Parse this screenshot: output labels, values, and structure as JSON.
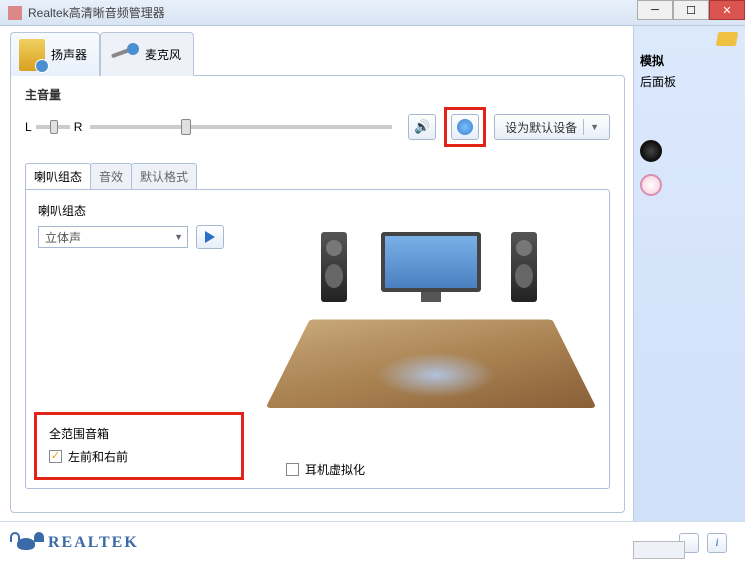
{
  "window": {
    "title": "Realtek高清晰音频管理器"
  },
  "tabs": {
    "speaker": "扬声器",
    "mic": "麦克风"
  },
  "volume": {
    "label": "主音量",
    "left": "L",
    "right": "R",
    "default_btn": "设为默认设备"
  },
  "subtabs": {
    "config": "喇叭组态",
    "effect": "音效",
    "fmt": "默认格式"
  },
  "config": {
    "heading": "喇叭组态",
    "combo_value": "立体声"
  },
  "fullrange": {
    "heading": "全范围音箱",
    "item": "左前和右前"
  },
  "hpvirt": "耳机虚拟化",
  "right": {
    "label": "模拟",
    "sub": "后面板"
  },
  "brand": "REALTEK",
  "info_btn": "i"
}
